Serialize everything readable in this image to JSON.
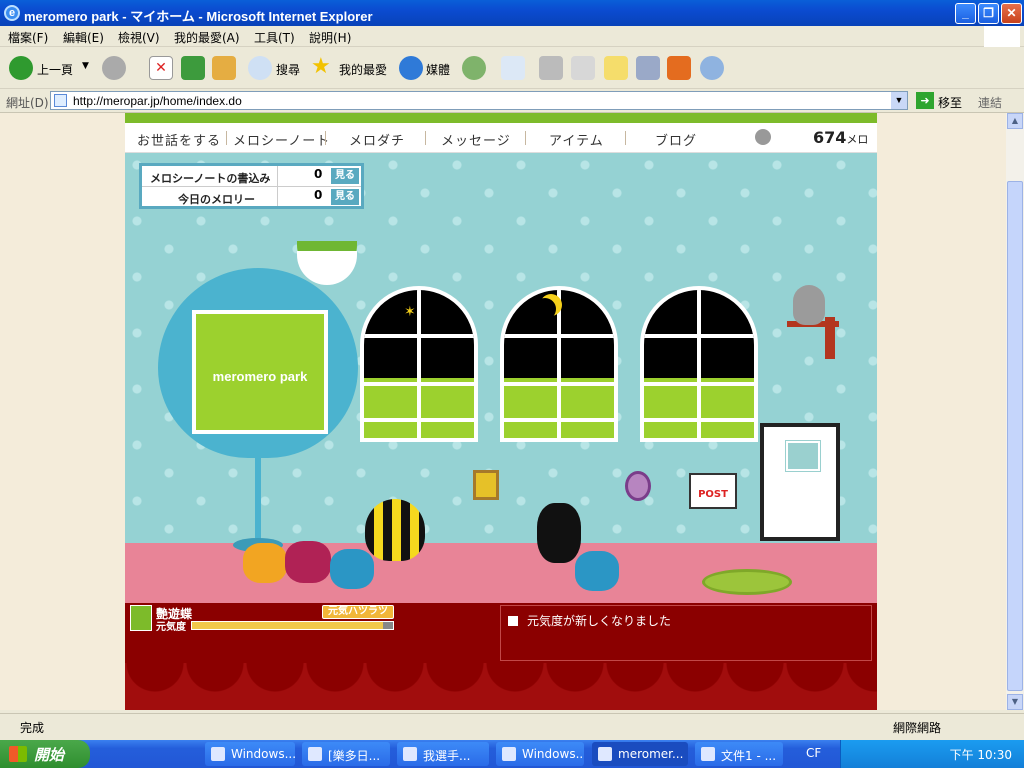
{
  "window": {
    "title": "meromero park - マイホーム - Microsoft Internet Explorer"
  },
  "menu": [
    "檔案(F)",
    "編輯(E)",
    "檢視(V)",
    "我的最愛(A)",
    "工具(T)",
    "說明(H)"
  ],
  "toolbar": {
    "back": "上一頁",
    "search": "搜尋",
    "favorites": "我的最愛",
    "media": "媒體"
  },
  "address": {
    "label": "網址(D)",
    "url": "http://meropar.jp/home/index.do",
    "go": "移至",
    "links": "連結"
  },
  "nav": {
    "items": [
      "お世話をする",
      "メロシーノート",
      "メロダチ",
      "メッセージ",
      "アイテム",
      "ブログ"
    ],
    "meron_value": "674",
    "meron_unit": "メロン"
  },
  "info": {
    "row1_label": "メロシーノートの書込み",
    "row1_value": "0",
    "row1_btn": "見る",
    "row2_label": "今日のメロリー",
    "row2_value": "0",
    "row2_btn": "見る"
  },
  "room": {
    "tv_text": "meromero park",
    "post_text": "POST"
  },
  "pet": {
    "name": "艷遊蝶",
    "genki_label": "元気度",
    "status_badge": "元気ハツラツ",
    "genki_level": 0.95
  },
  "message": {
    "text": "元気度が新しくなりました"
  },
  "status": {
    "done": "完成",
    "zone": "網際網路"
  },
  "taskbar": {
    "start": "開始",
    "tasks": [
      "Windows...",
      "[樂多日...",
      "我選手...",
      "Windows...",
      "meromer...",
      "文件1 - ..."
    ],
    "tray_extra": "CF",
    "clock": "下午 10:30"
  }
}
